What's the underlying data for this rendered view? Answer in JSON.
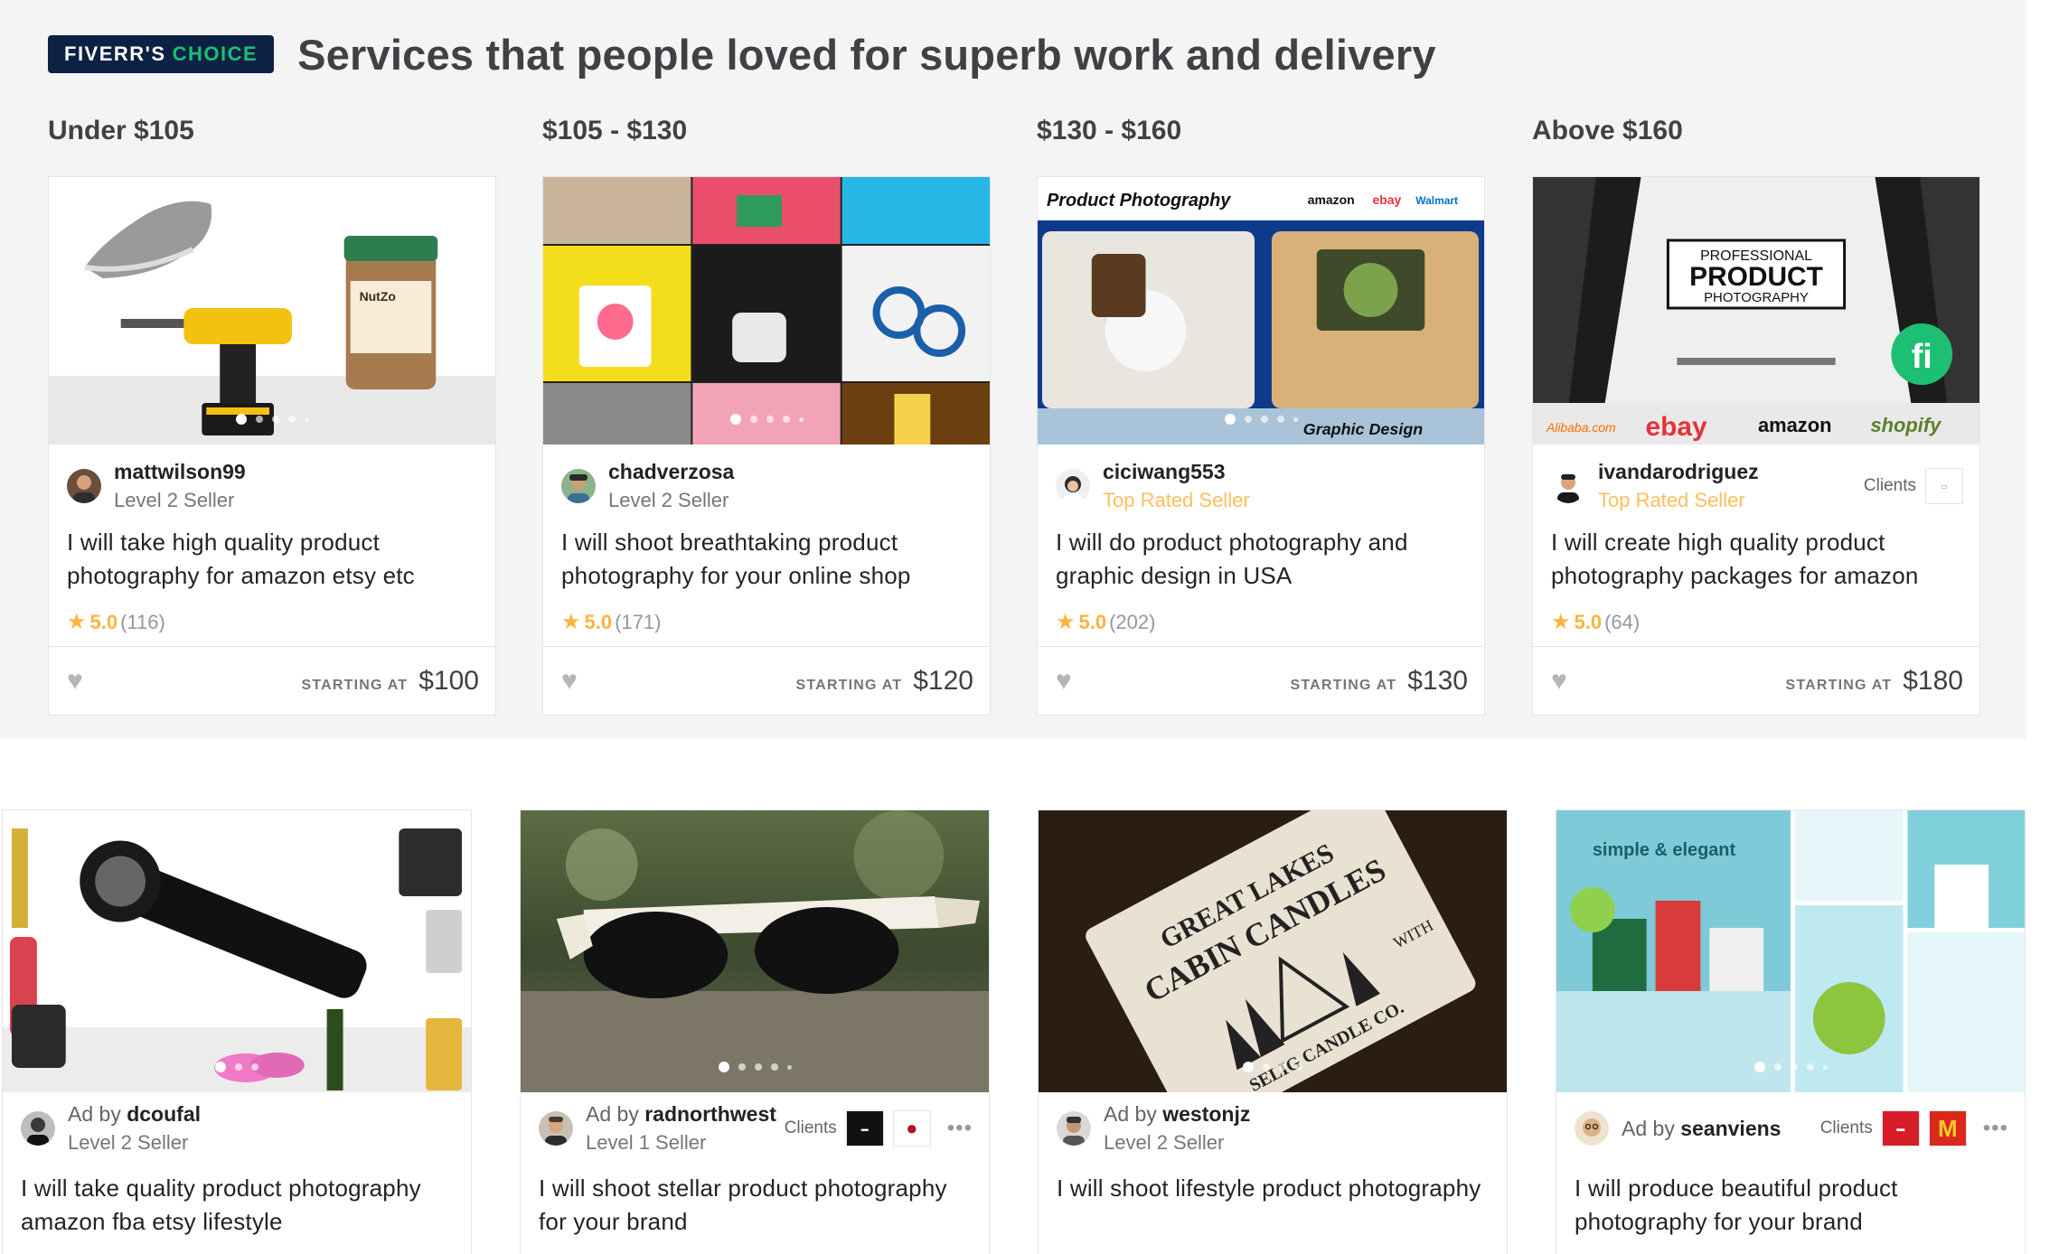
{
  "header": {
    "badge_part1": "FIVERR'S",
    "badge_part2": "CHOICE",
    "title": "Services that people loved for superb work and delivery"
  },
  "colors": {
    "accent_green": "#1dbf73",
    "badge_navy": "#0d2145",
    "star": "#ffb33e",
    "top_rated": "#ffbe5b"
  },
  "choice_columns": [
    {
      "price_range": "Under $105",
      "image_icon": "product-photo-sneaker-drill-jar",
      "seller": "mattwilson99",
      "level": "Level 2 Seller",
      "title": "I will take high quality product photography for amazon etsy etc",
      "rating": "5.0",
      "reviews": "(116)",
      "starting_label": "STARTING AT",
      "price": "$100"
    },
    {
      "price_range": "$105 - $130",
      "image_icon": "product-photo-collage",
      "seller": "chadverzosa",
      "level": "Level 2 Seller",
      "title": "I will shoot breathtaking product photography for your online shop",
      "rating": "5.0",
      "reviews": "(171)",
      "starting_label": "STARTING AT",
      "price": "$120"
    },
    {
      "price_range": "$130 - $160",
      "image_icon": "product-photography-graphic-design",
      "image_text_top": "Product Photography",
      "image_logos": [
        "amazon",
        "ebay",
        "Walmart"
      ],
      "image_text_bottom": "Graphic Design",
      "seller": "ciciwang553",
      "level": "Top Rated Seller",
      "title": "I will do product photography and graphic design in USA",
      "rating": "5.0",
      "reviews": "(202)",
      "starting_label": "STARTING AT",
      "price": "$130"
    },
    {
      "price_range": "Above $160",
      "image_icon": "professional-product-photography-studio",
      "image_text": [
        "PROFESSIONAL",
        "PRODUCT",
        "PHOTOGRAPHY"
      ],
      "image_logos": [
        "Alibaba.com",
        "ebay",
        "amazon",
        "shopify"
      ],
      "seller": "ivandarodriguez",
      "level": "Top Rated Seller",
      "clients_label": "Clients",
      "title": "I will create high quality product photography packages for amazon",
      "rating": "5.0",
      "reviews": "(64)",
      "starting_label": "STARTING AT",
      "price": "$180"
    }
  ],
  "ads": [
    {
      "ad_prefix": "Ad by",
      "seller": "dcoufal",
      "level": "Level 2 Seller",
      "image_icon": "flashlight-product-collage",
      "title": "I will take quality product photography amazon fba etsy lifestyle"
    },
    {
      "ad_prefix": "Ad by",
      "seller": "radnorthwest",
      "level": "Level 1 Seller",
      "clients_label": "Clients",
      "image_icon": "sunglasses-on-moss",
      "title": "I will shoot stellar product photography for your brand"
    },
    {
      "ad_prefix": "Ad by",
      "seller": "westonjz",
      "level": "Level 2 Seller",
      "image_icon": "candle-label",
      "image_text": [
        "GREAT LAKES",
        "CABIN CANDLES",
        "WITH",
        "SELIG CANDLE CO."
      ],
      "title": "I will shoot lifestyle product photography"
    },
    {
      "ad_prefix": "Ad by",
      "seller": "seanviens",
      "clients_label": "Clients",
      "image_icon": "simple-elegant-collage",
      "image_text": "simple & elegant",
      "title": "I will produce beautiful product photography for your brand"
    }
  ]
}
